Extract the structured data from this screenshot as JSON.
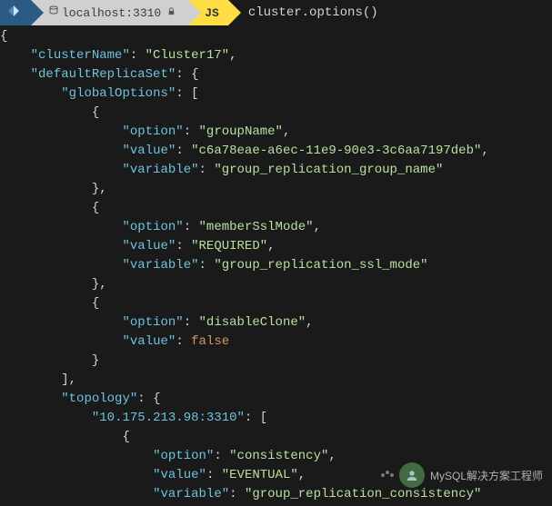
{
  "prompt": {
    "mysql_icon": "⟡",
    "db_icon": "🗄",
    "host": "localhost:3310",
    "ssl_icon": "🔒",
    "mode": "JS",
    "command": "cluster.options()"
  },
  "output_lines": [
    "{",
    "    \"clusterName\": \"Cluster17\",",
    "    \"defaultReplicaSet\": {",
    "        \"globalOptions\": [",
    "            {",
    "                \"option\": \"groupName\",",
    "                \"value\": \"c6a78eae-a6ec-11e9-90e3-3c6aa7197deb\",",
    "                \"variable\": \"group_replication_group_name\"",
    "            },",
    "            {",
    "                \"option\": \"memberSslMode\",",
    "                \"value\": \"REQUIRED\",",
    "                \"variable\": \"group_replication_ssl_mode\"",
    "            },",
    "            {",
    "                \"option\": \"disableClone\",",
    "                \"value\": false",
    "            }",
    "        ],",
    "        \"topology\": {",
    "            \"10.175.213.98:3310\": [",
    "                {",
    "                    \"option\": \"consistency\",",
    "                    \"value\": \"EVENTUAL\",",
    "                    \"variable\": \"group_replication_consistency\""
  ],
  "watermark": {
    "text": "MySQL解决方案工程师"
  },
  "chart_data": null
}
